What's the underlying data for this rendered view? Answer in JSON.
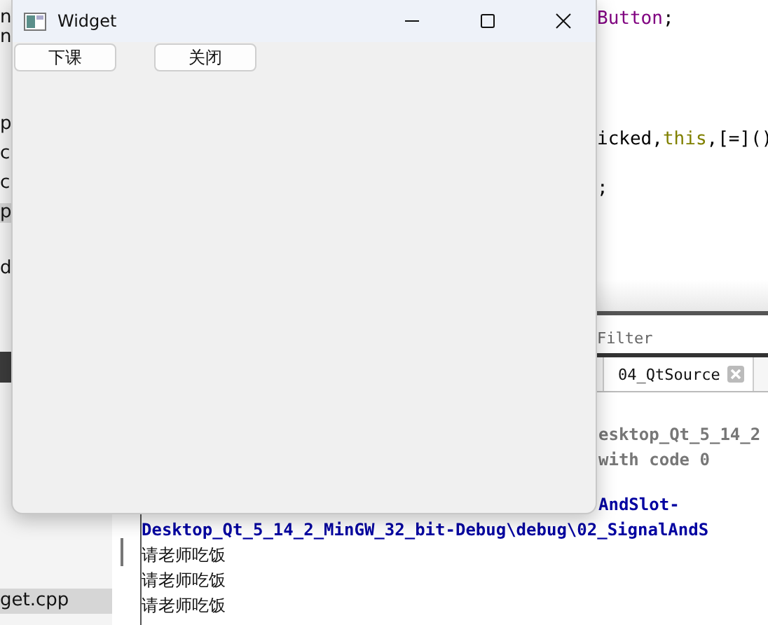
{
  "window": {
    "title": "Widget",
    "buttons": [
      {
        "label": "下课"
      },
      {
        "label": "关闭"
      }
    ]
  },
  "sidebar": [
    {
      "text": "n",
      "selected": false
    },
    {
      "text": "n",
      "selected": false
    },
    {
      "text": "p",
      "selected": false
    },
    {
      "text": "c",
      "selected": false
    },
    {
      "text": "c",
      "selected": false
    },
    {
      "text": "p",
      "selected": true
    },
    {
      "text": "d",
      "selected": false
    },
    {
      "text": "get.cpp",
      "selected": true
    }
  ],
  "editor": [
    [
      {
        "text": "Button",
        "kind": "type"
      },
      {
        "text": ";",
        "kind": "plain"
      }
    ],
    [
      {
        "text": "icked,",
        "kind": "plain"
      },
      {
        "text": "this",
        "kind": "keyword"
      },
      {
        "text": ",[=]()",
        "kind": "plain"
      }
    ],
    [
      {
        "text": ";",
        "kind": "plain"
      }
    ]
  ],
  "output": {
    "filter": "Filter",
    "tabs": [
      {
        "label": "04_QtSource"
      }
    ],
    "lines": [
      {
        "text": "esktop_Qt_5_14_2",
        "kind": "info"
      },
      {
        "text": "with code 0",
        "kind": "info"
      },
      {
        "text": "AndSlot-",
        "kind": "path"
      },
      {
        "text": "Desktop_Qt_5_14_2_MinGW_32_bit-Debug\\debug\\02_SignalAndS",
        "kind": "path"
      },
      {
        "text": "请老师吃饭",
        "kind": "plain"
      },
      {
        "text": "请老师吃饭",
        "kind": "plain"
      },
      {
        "text": "请老师吃饭",
        "kind": "plain"
      }
    ]
  }
}
